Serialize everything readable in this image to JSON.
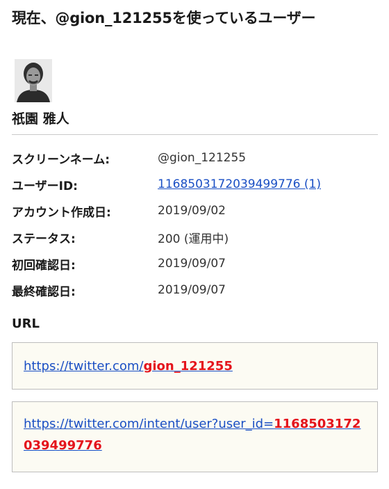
{
  "page": {
    "title": "現在、@gion_121255を使っているユーザー"
  },
  "user": {
    "name": "祇園 雅人",
    "avatar_icon": "user-avatar-photo"
  },
  "info": {
    "rows": [
      {
        "label": "スクリーンネーム:",
        "value": "@gion_121255"
      },
      {
        "label": "ユーザーID:",
        "value": "1168503172039499776 (1)"
      },
      {
        "label": "アカウント作成日:",
        "value": "2019/09/02"
      },
      {
        "label": "ステータス:",
        "value": "200 (運用中)"
      },
      {
        "label": "初回確認日:",
        "value": "2019/09/07"
      },
      {
        "label": "最終確認日:",
        "value": "2019/09/07"
      }
    ]
  },
  "url_section": {
    "title": "URL",
    "links": [
      {
        "prefix": "https://twitter.com/",
        "highlight": "gion_121255"
      },
      {
        "prefix": "https://twitter.com/intent/user?user_id=",
        "highlight": "1168503172039499776"
      }
    ]
  },
  "colors": {
    "link": "#1a4fc4",
    "highlight": "#e4141c",
    "box_background": "#fcfbf3"
  }
}
